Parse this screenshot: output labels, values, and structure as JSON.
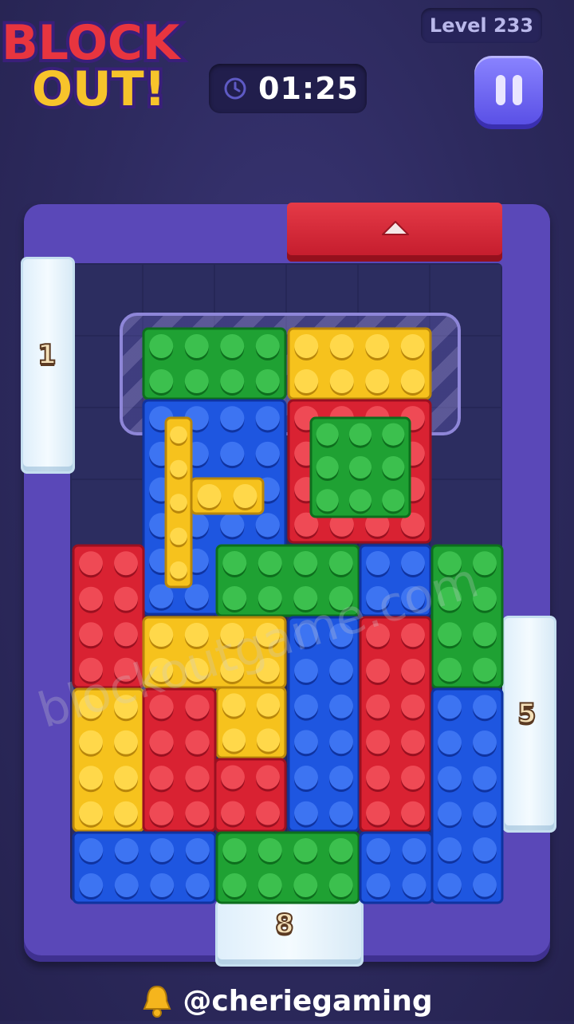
{
  "header": {
    "logo_line1": "BLOCK",
    "logo_line2": "OUT!",
    "level_label": "Level 233",
    "timer_value": "01:25",
    "pause_icon": "pause-icon"
  },
  "board": {
    "exits": [
      {
        "name": "exit-top",
        "color": "#d52233"
      }
    ],
    "ice_counters": [
      {
        "name": "ice-left",
        "value": "1"
      },
      {
        "name": "ice-right",
        "value": "5"
      },
      {
        "name": "ice-bottom",
        "value": "8"
      }
    ]
  },
  "colors": {
    "red": "#d92232",
    "yellow": "#f6c21d",
    "green": "#1fa133",
    "blue": "#1e56e0",
    "frame": "#5a48b8"
  },
  "watermark": "blockoutgame.com",
  "footer": {
    "handle": "@cheriegaming",
    "icon": "bell-icon"
  }
}
